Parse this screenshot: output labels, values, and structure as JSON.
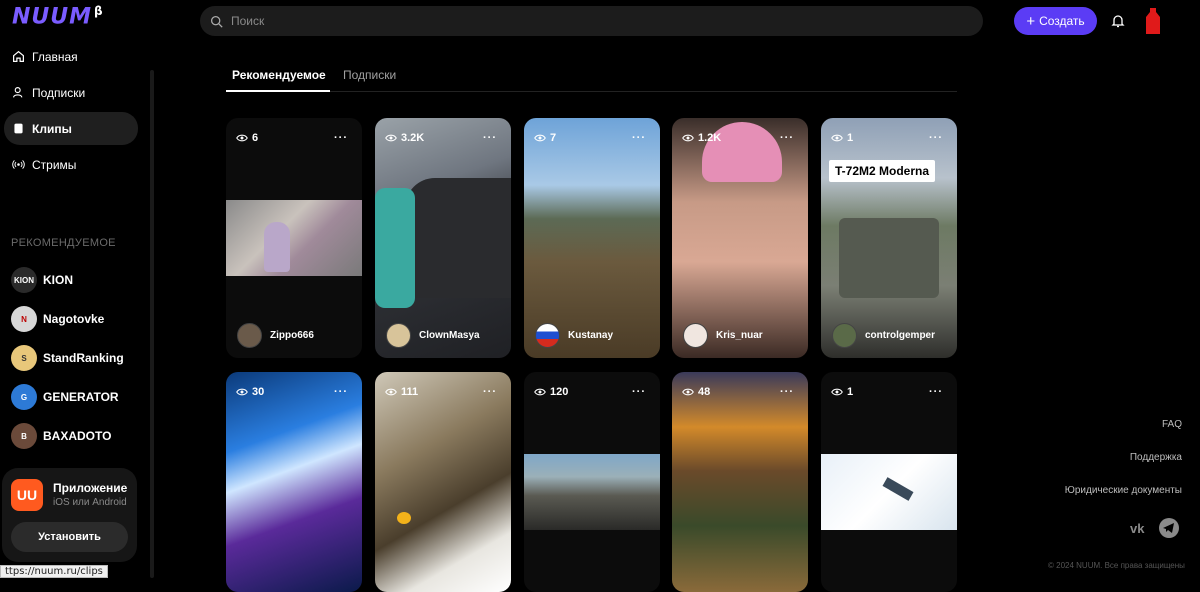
{
  "logo": {
    "text": "NUUM",
    "beta": "β"
  },
  "nav": [
    {
      "label": "Главная",
      "icon": "home-icon"
    },
    {
      "label": "Подписки",
      "icon": "subscriptions-icon"
    },
    {
      "label": "Клипы",
      "icon": "clips-icon",
      "active": true
    },
    {
      "label": "Стримы",
      "icon": "streams-icon"
    }
  ],
  "recommended": {
    "title": "РЕКОМЕНДУЕМОЕ",
    "channels": [
      {
        "name": "KION",
        "avatar_text": "KION",
        "color": "#2a2a2a"
      },
      {
        "name": "Nagotovke",
        "avatar_text": "N",
        "color": "#d7d7d7"
      },
      {
        "name": "StandRanking",
        "avatar_text": "S",
        "color": "#e8c77a"
      },
      {
        "name": "GENERATOR",
        "avatar_text": "G",
        "color": "#2d7ad6"
      },
      {
        "name": "BAXADOTO",
        "avatar_text": "B",
        "color": "#6b4a3a"
      }
    ]
  },
  "app_promo": {
    "title": "Приложение",
    "subtitle": "iOS или Android",
    "button": "Установить"
  },
  "status_url": "ttps://nuum.ru/clips",
  "search": {
    "placeholder": "Поиск"
  },
  "header": {
    "create_label": "Создать"
  },
  "tabs": [
    {
      "label": "Рекомендуемое",
      "active": true
    },
    {
      "label": "Подписки",
      "active": false
    }
  ],
  "clips_row1": [
    {
      "views": "6",
      "author": "Zippo666"
    },
    {
      "views": "3.2K",
      "author": "ClownMasya"
    },
    {
      "views": "7",
      "author": "Kustanay"
    },
    {
      "views": "1.2K",
      "author": "Kris_nuar"
    },
    {
      "views": "1",
      "author": "controlgemper",
      "overlay": "T-72M2 Moderna"
    }
  ],
  "clips_row2": [
    {
      "views": "30"
    },
    {
      "views": "111"
    },
    {
      "views": "120"
    },
    {
      "views": "48"
    },
    {
      "views": "1"
    }
  ],
  "more_label": "···",
  "footer": {
    "links": [
      "FAQ",
      "Поддержка",
      "Юридические документы"
    ],
    "copyright": "© 2024 NUUM. Все права защищены"
  },
  "colors": {
    "accent": "#5b3cf5",
    "background": "#000000"
  }
}
